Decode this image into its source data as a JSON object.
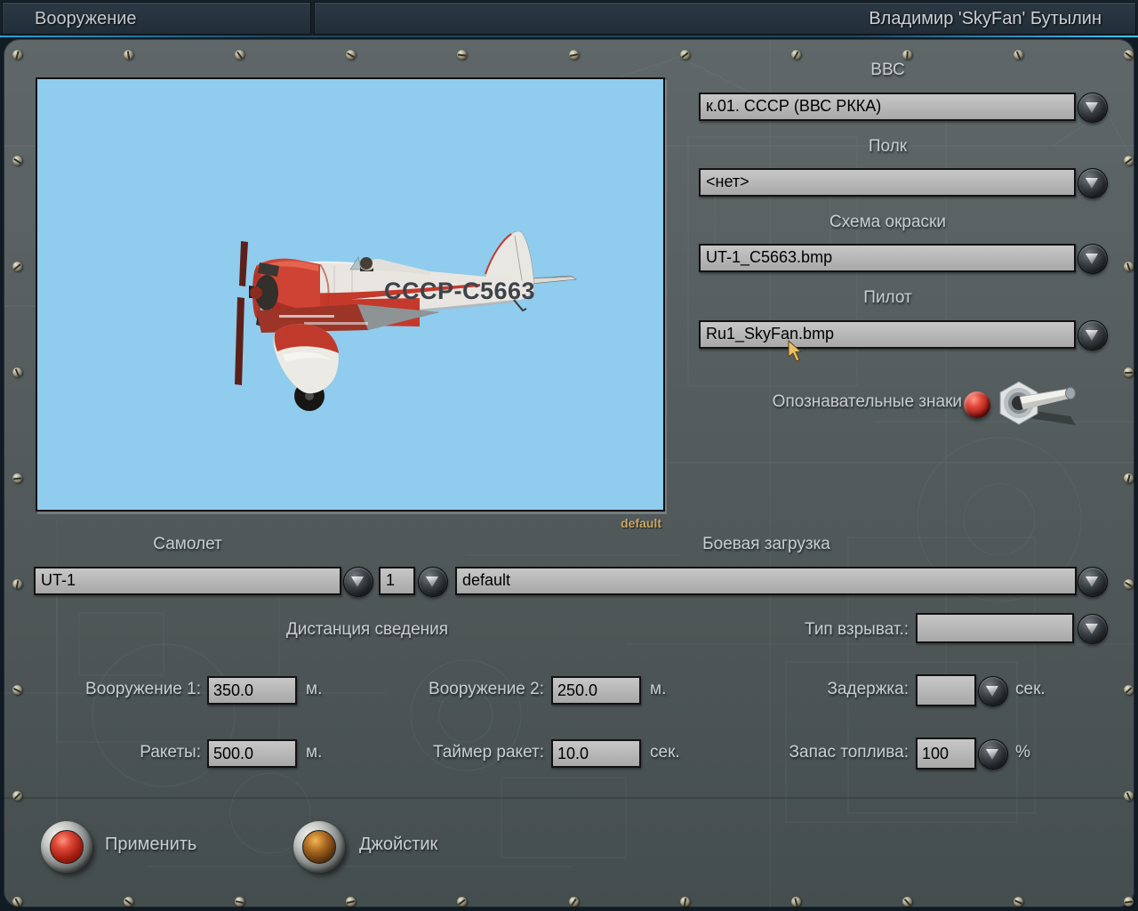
{
  "header": {
    "tab_armament": "Вооружение",
    "pilot_name": "Владимир 'SkyFan' Бутылин"
  },
  "right_panel": {
    "vvs_label": "ВВС",
    "vvs_value": "к.01. СССР (ВВС РККА)",
    "regiment_label": "Полк",
    "regiment_value": "<нет>",
    "paint_label": "Схема окраски",
    "paint_value": "UT-1_C5663.bmp",
    "pilot_label": "Пилот",
    "pilot_value": "Ru1_SkyFan.bmp",
    "markings_label": "Опознавательные знаки"
  },
  "preview": {
    "registration": "СССР-С5663",
    "variant_label": "default"
  },
  "aircraft_row": {
    "aircraft_label": "Самолет",
    "aircraft_value": "UT-1",
    "count_value": "1",
    "loadout_label": "Боевая загрузка",
    "loadout_value": "default"
  },
  "convergence": {
    "section_label": "Дистанция сведения",
    "fuse_label": "Тип взрыват.:",
    "fuse_value": "",
    "weapon1_label": "Вооружение 1:",
    "weapon1_value": "350.0",
    "weapon1_unit": "м.",
    "weapon2_label": "Вооружение 2:",
    "weapon2_value": "250.0",
    "weapon2_unit": "м.",
    "delay_label": "Задержка:",
    "delay_value": "",
    "delay_unit": "сек.",
    "rockets_label": "Ракеты:",
    "rockets_value": "500.0",
    "rockets_unit": "м.",
    "rocket_timer_label": "Таймер ракет:",
    "rocket_timer_value": "10.0",
    "rocket_timer_unit": "сек.",
    "fuel_label": "Запас топлива:",
    "fuel_value": "100",
    "fuel_unit": "%"
  },
  "actions": {
    "apply_label": "Применить",
    "joystick_label": "Джойстик"
  },
  "colors": {
    "accent_blue": "#3aa7ef",
    "panel_gray": "#515a5d",
    "field_gray": "#b4b4b4",
    "sky_blue": "#8fccee",
    "apply_button_red": "#c0392b",
    "joystick_button_amber": "#7a4a10",
    "variant_tan": "#c9a763",
    "label_gray": "#c8cdd1"
  }
}
